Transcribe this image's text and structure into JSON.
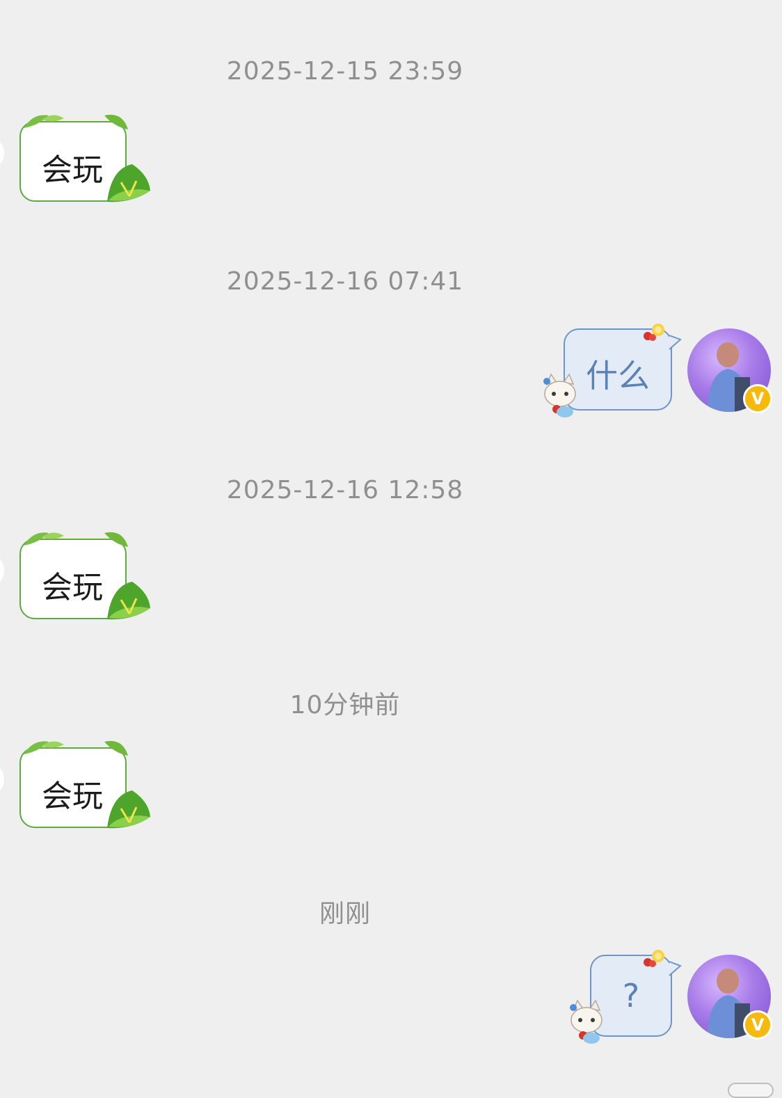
{
  "conversation": {
    "messages": [
      {
        "timestamp": "2025-12-15 23:59",
        "sender": "other",
        "text": "会玩"
      },
      {
        "timestamp": "2025-12-16 07:41",
        "sender": "self",
        "text": "什么"
      },
      {
        "timestamp": "2025-12-16 12:58",
        "sender": "other",
        "text": "会玩"
      },
      {
        "timestamp": "10分钟前",
        "sender": "other",
        "text": "会玩"
      },
      {
        "timestamp": "刚刚",
        "sender": "self",
        "text": "?"
      }
    ]
  },
  "self_avatar": {
    "badge": "V",
    "badge_color": "#f6b90c"
  },
  "colors": {
    "background": "#efefef",
    "incoming_border": "#5cab3c",
    "outgoing_fill": "#e2ebf6",
    "outgoing_border": "#6f95c8",
    "outgoing_text": "#5a82b6",
    "timestamp_text": "#8f8f8f"
  },
  "icons": [
    "bamboo-leaf-icon",
    "zongzi-icon",
    "cat-sticker-icon",
    "fruit-icon",
    "verified-badge-icon"
  ]
}
